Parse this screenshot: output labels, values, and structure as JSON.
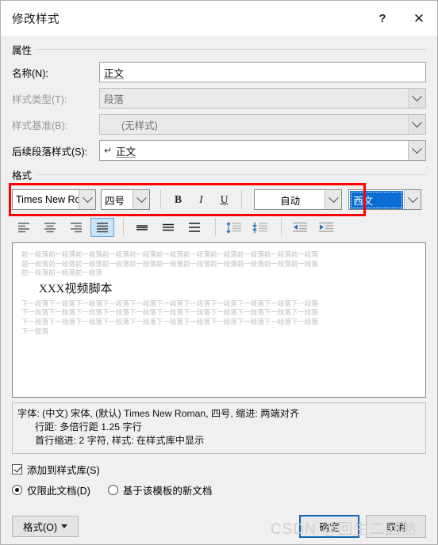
{
  "window": {
    "title": "修改样式",
    "help_icon": "?",
    "close_icon": "✕"
  },
  "properties": {
    "group_label": "属性",
    "fields": [
      {
        "label": "名称(N):",
        "value": "正文",
        "type": "text",
        "disabled": false
      },
      {
        "label": "样式类型(T):",
        "value": "段落",
        "type": "combo",
        "disabled": true
      },
      {
        "label": "样式基准(B):",
        "value": "(无样式)",
        "type": "combo",
        "disabled": true
      },
      {
        "label": "后续段落样式(S):",
        "value": "正文",
        "type": "combo",
        "disabled": false,
        "prefix": "↵"
      }
    ]
  },
  "format": {
    "group_label": "格式",
    "highlight_color": "#ff0000",
    "font_name": "Times New Ro",
    "font_size": "四号",
    "bold_label": "B",
    "italic_label": "I",
    "underline_label": "U",
    "font_color": "自动",
    "script_type": "西文",
    "script_selected_color": "#0a6cd4"
  },
  "paragraph": {
    "align_left": "align-left",
    "align_center": "align-center",
    "align_right": "align-right",
    "align_justify": "align-justify",
    "line_spacing_single": "line-spacing-1",
    "line_spacing_1_5": "line-spacing-1-5",
    "line_spacing_double": "line-spacing-2",
    "space_before": "add-space-before",
    "space_after": "remove-space-after",
    "indent_decrease": "decrease-indent",
    "indent_increase": "increase-indent",
    "active_alignment": "align-justify",
    "accent_color": "#5ba7e0"
  },
  "preview": {
    "before_lines": [
      "前一段落前一段落前一段落前一段落前一段落前一段落前一段落前一段落前一段落前一段落前一段落",
      "前一段落前一段落前一段落前一段落前一段落前一段落前一段落前一段落前一段落前一段落前一段落",
      "前一段落前一段落前一段落"
    ],
    "heading": "XXX视频脚本",
    "after_lines": [
      "下一段落下一段落下一段落下一段落下一段落下一段落下一段落下一段落下一段落下一段落下一段落",
      "下一段落下一段落下一段落下一段落下一段落下一段落下一段落下一段落下一段落下一段落下一段落",
      "下一段落下一段落下一段落下一段落下一段落下一段落下一段落下一段落下一段落下一段落下一段落",
      "下一段落"
    ]
  },
  "description": {
    "line1": "字体: (中文) 宋体, (默认) Times New Roman, 四号, 缩进: 两端对齐",
    "line2": "行距: 多倍行距 1.25 字行",
    "line3": "首行缩进:  2 字符, 样式: 在样式库中显示"
  },
  "options": {
    "add_to_gallery": {
      "label": "添加到样式库(S)",
      "checked": true
    },
    "scope_this_doc": {
      "label": "仅限此文档(D)",
      "selected": true
    },
    "scope_template": {
      "label": "基于该模板的新文档",
      "selected": false
    }
  },
  "footer": {
    "format_button": "格式(O)",
    "ok_button": "确定",
    "cancel_button": "取消"
  },
  "watermark": {
    "text": "CSDN @回生二回熟"
  }
}
